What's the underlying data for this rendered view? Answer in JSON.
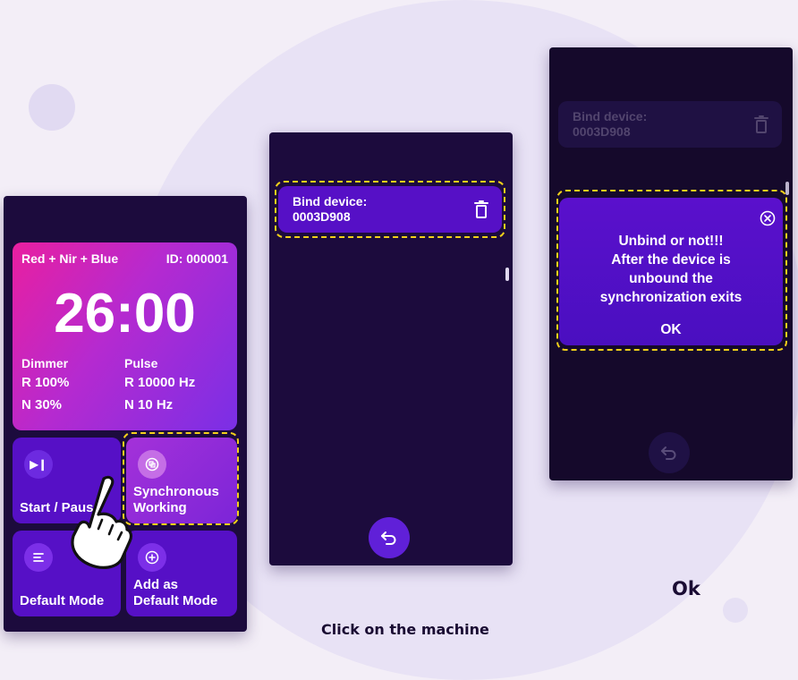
{
  "main_card": {
    "mode": "Red + Nir + Blue",
    "device_id": "ID: 000001",
    "timer": "26:00",
    "dimmer": {
      "header": "Dimmer",
      "r": "R 100%",
      "n": "N 30%"
    },
    "pulse": {
      "header": "Pulse",
      "r": "R 10000 Hz",
      "n": "N 10 Hz"
    }
  },
  "tiles": {
    "start_pause": {
      "label": "Start / Pause",
      "icon": "play-pause-icon"
    },
    "sync": {
      "label_line1": "Synchronous",
      "label_line2": "Working",
      "icon": "sync-icon"
    },
    "default_mode": {
      "label": "Default Mode",
      "icon": "list-icon"
    },
    "add_default": {
      "label_line1": "Add as",
      "label_line2": "Default Mode",
      "icon": "plus-icon"
    }
  },
  "bind_screen": {
    "label": "Bind device:",
    "device": "0003D908"
  },
  "unbind_dialog": {
    "line1": "Unbind or not!!!",
    "line2": "After the device is",
    "line3": "unbound the",
    "line4": "synchronization exits",
    "ok": "OK"
  },
  "captions": {
    "ok": "Ok",
    "click": "Click on the machine"
  },
  "colors": {
    "accent": "#5610c6",
    "highlight_dash": "#f3d11a",
    "phone_bg": "#1c0b3d"
  }
}
